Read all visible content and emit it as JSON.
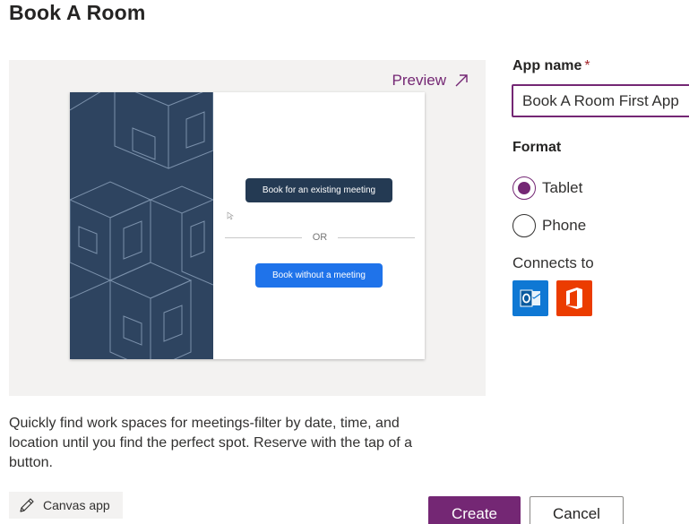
{
  "page": {
    "title": "Book A Room"
  },
  "preview": {
    "link_label": "Preview",
    "link_icon": "arrow-up-right-icon",
    "thumbnail": {
      "primary_button": "Book for an existing meeting",
      "separator": "OR",
      "secondary_button": "Book without a meeting",
      "colors": {
        "art_background": "#2e4460",
        "primary": "#243a53",
        "secondary": "#1f73ea"
      }
    }
  },
  "description": "Quickly find work spaces for meetings-filter by date, time, and location until you find the perfect spot. Reserve with the tap of a button.",
  "app_type": {
    "label": "Canvas app",
    "icon": "pencil-icon"
  },
  "form": {
    "app_name_label": "App name",
    "required_marker": "*",
    "app_name_value": "Book A Room First App",
    "format_label": "Format",
    "format_options": [
      {
        "label": "Tablet",
        "selected": true
      },
      {
        "label": "Phone",
        "selected": false
      }
    ],
    "connects_label": "Connects to",
    "connectors": [
      {
        "name": "outlook-icon",
        "color": "#0f78d4"
      },
      {
        "name": "office-icon",
        "color": "#eb3c00"
      }
    ]
  },
  "actions": {
    "create_label": "Create",
    "cancel_label": "Cancel"
  },
  "colors": {
    "accent": "#742774",
    "required": "#a4262c"
  }
}
